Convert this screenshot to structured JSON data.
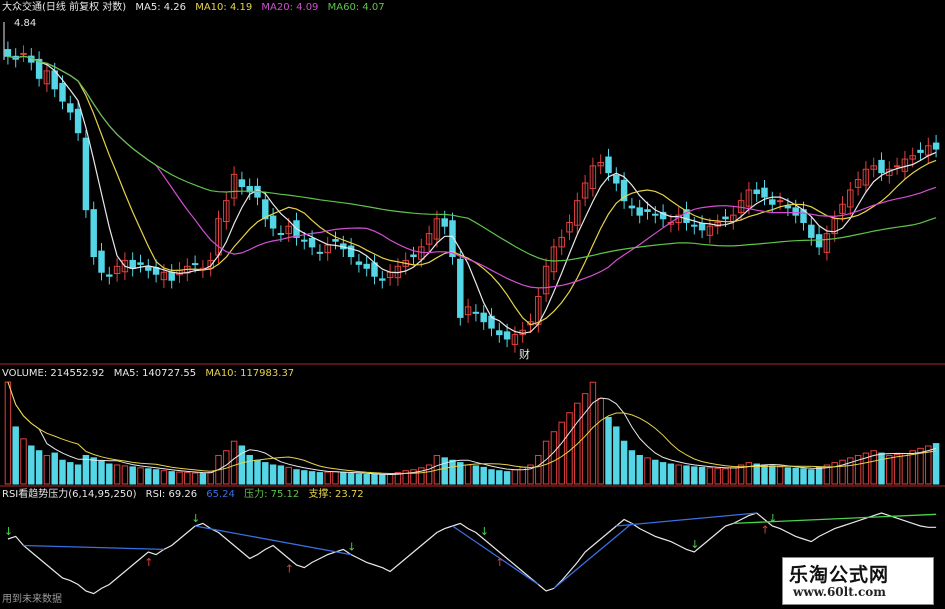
{
  "header": {
    "stock_title": "大众交通(日线 前复权 对数)",
    "ma5_label": "MA5: 4.26",
    "ma10_label": "MA10: 4.19",
    "ma20_label": "MA20: 4.09",
    "ma60_label": "MA60: 4.07",
    "price_high_label": "4.84"
  },
  "volume_header": {
    "volume_label": "VOLUME: 214552.92",
    "ma5_label": "MA5: 140727.55",
    "ma10_label": "MA10: 117983.37"
  },
  "rsi_header": {
    "indicator_label": "RSI看趋势压力(6,14,95,250)",
    "rsi_label": "RSI: 69.26",
    "rsi_value2": "65.24",
    "pressure_label": "压力: 75.12",
    "support_label": "支撑: 23.72"
  },
  "annotations": {
    "cai_marker": "财",
    "footer_text": "用到未来数据"
  },
  "watermark": {
    "title": "乐淘公式网",
    "url": "www.60lt.com"
  },
  "colors": {
    "up": "#e0413f",
    "down": "#54d6e6",
    "ma5": "#e8e8e8",
    "ma10": "#e6d34a",
    "ma20": "#d24fd2",
    "ma60": "#5fc44a",
    "rsi_line": "#e8e8e8",
    "trend_down": "#3a6fe0",
    "trend_up": "#4cd24c",
    "divider": "#b02828"
  },
  "chart_data": {
    "type": "candlestick",
    "title": "大众交通(日线 前复权 对数)",
    "ylim": [
      3.05,
      4.9
    ],
    "price_high": 4.84,
    "n_days": 120,
    "close": [
      4.7,
      4.68,
      4.72,
      4.66,
      4.55,
      4.6,
      4.48,
      4.4,
      4.33,
      4.2,
      3.75,
      3.5,
      3.42,
      3.4,
      3.45,
      3.48,
      3.44,
      3.46,
      3.43,
      3.41,
      3.42,
      3.38,
      3.43,
      3.45,
      3.46,
      3.44,
      3.48,
      3.7,
      3.8,
      3.95,
      3.88,
      3.85,
      3.82,
      3.7,
      3.65,
      3.62,
      3.66,
      3.6,
      3.58,
      3.55,
      3.52,
      3.56,
      3.58,
      3.54,
      3.5,
      3.46,
      3.44,
      3.4,
      3.38,
      3.42,
      3.45,
      3.48,
      3.5,
      3.55,
      3.62,
      3.7,
      3.66,
      3.5,
      3.2,
      3.25,
      3.22,
      3.18,
      3.15,
      3.12,
      3.1,
      3.12,
      3.14,
      3.18,
      3.3,
      3.45,
      3.55,
      3.6,
      3.68,
      3.8,
      3.9,
      4.0,
      4.02,
      3.96,
      3.9,
      3.8,
      3.76,
      3.72,
      3.74,
      3.72,
      3.7,
      3.68,
      3.72,
      3.68,
      3.66,
      3.64,
      3.66,
      3.68,
      3.7,
      3.72,
      3.8,
      3.86,
      3.84,
      3.82,
      3.78,
      3.8,
      3.76,
      3.72,
      3.68,
      3.6,
      3.55,
      3.62,
      3.7,
      3.78,
      3.86,
      3.92,
      3.98,
      4.0,
      3.96,
      3.98,
      4.0,
      4.04,
      4.06,
      4.08,
      4.12,
      4.1
    ],
    "volume": [
      214552,
      120000,
      95000,
      80000,
      70000,
      60000,
      65000,
      50000,
      45000,
      40000,
      60000,
      55000,
      48000,
      42000,
      40000,
      38000,
      36000,
      34000,
      32000,
      30000,
      28000,
      26000,
      25000,
      24000,
      23000,
      22000,
      24000,
      60000,
      70000,
      90000,
      80000,
      60000,
      50000,
      45000,
      40000,
      38000,
      35000,
      30000,
      28000,
      26000,
      24000,
      25000,
      26000,
      24000,
      22000,
      21000,
      20000,
      20000,
      19000,
      20000,
      24000,
      28000,
      30000,
      34000,
      40000,
      60000,
      55000,
      50000,
      45000,
      40000,
      38000,
      35000,
      30000,
      28000,
      26000,
      30000,
      35000,
      40000,
      60000,
      90000,
      110000,
      130000,
      150000,
      170000,
      190000,
      214000,
      180000,
      140000,
      120000,
      90000,
      70000,
      60000,
      55000,
      50000,
      45000,
      42000,
      40000,
      38000,
      36000,
      35000,
      34000,
      33000,
      32000,
      34000,
      40000,
      45000,
      42000,
      40000,
      38000,
      36000,
      34000,
      33000,
      32000,
      30000,
      35000,
      40000,
      45000,
      50000,
      55000,
      60000,
      65000,
      70000,
      65000,
      60000,
      62000,
      64000,
      70000,
      75000,
      80000,
      85000
    ],
    "rsi": [
      60,
      62,
      55,
      50,
      45,
      40,
      35,
      30,
      28,
      25,
      20,
      18,
      22,
      25,
      30,
      35,
      40,
      45,
      50,
      48,
      52,
      55,
      60,
      65,
      70,
      72,
      68,
      65,
      60,
      55,
      50,
      45,
      48,
      52,
      55,
      50,
      45,
      40,
      38,
      42,
      45,
      48,
      50,
      52,
      48,
      45,
      42,
      40,
      38,
      35,
      40,
      45,
      50,
      55,
      60,
      65,
      68,
      70,
      72,
      68,
      65,
      60,
      55,
      50,
      45,
      40,
      35,
      30,
      25,
      20,
      22,
      28,
      35,
      42,
      50,
      55,
      60,
      65,
      70,
      75,
      72,
      68,
      65,
      62,
      60,
      58,
      55,
      52,
      50,
      55,
      60,
      65,
      70,
      72,
      75,
      78,
      80,
      75,
      70,
      68,
      65,
      62,
      60,
      58,
      62,
      65,
      68,
      70,
      72,
      74,
      76,
      78,
      80,
      78,
      76,
      74,
      72,
      70,
      69,
      69
    ],
    "series": [
      {
        "name": "MA5",
        "value": 4.26
      },
      {
        "name": "MA10",
        "value": 4.19
      },
      {
        "name": "MA20",
        "value": 4.09
      },
      {
        "name": "MA60",
        "value": 4.07
      }
    ],
    "volume_series": [
      {
        "name": "VOLUME",
        "value": 214552.92
      },
      {
        "name": "MA5",
        "value": 140727.55
      },
      {
        "name": "MA10",
        "value": 117983.37
      }
    ],
    "rsi_series": [
      {
        "name": "RSI",
        "value": 69.26
      },
      {
        "name": "压力",
        "value": 75.12
      },
      {
        "name": "支撑",
        "value": 23.72
      }
    ]
  }
}
